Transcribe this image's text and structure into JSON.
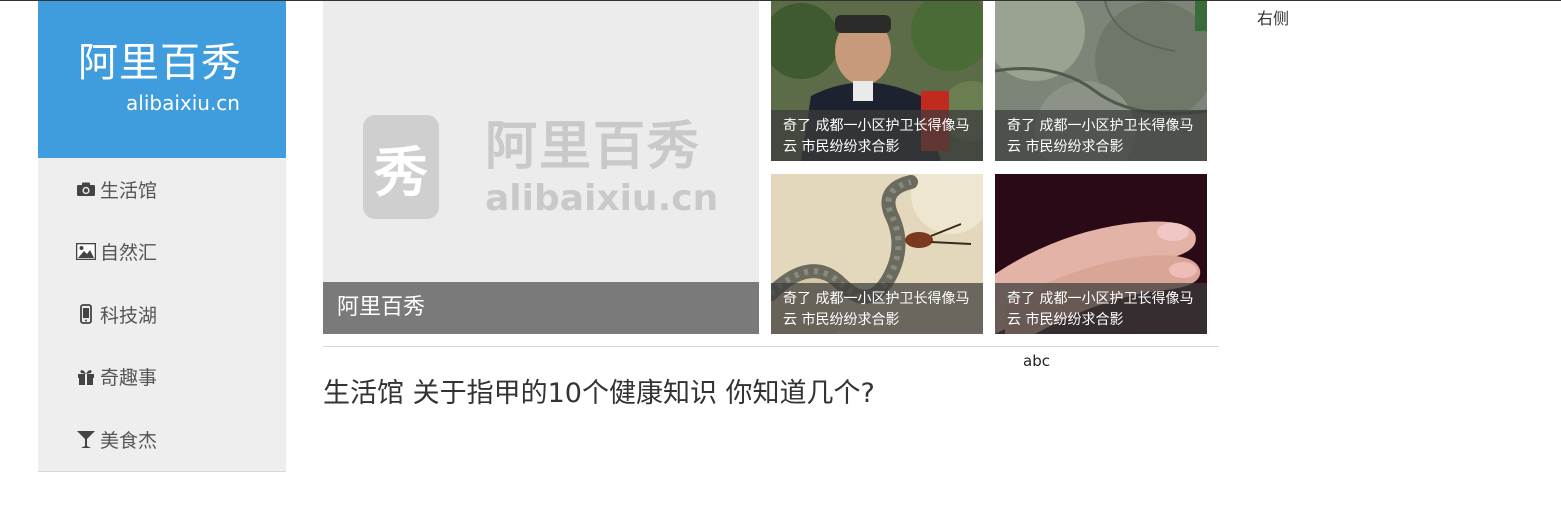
{
  "logo": {
    "cn": "阿里百秀",
    "en": "alibaixiu.cn"
  },
  "sidebar": {
    "items": [
      {
        "label": "生活馆",
        "icon": "camera-icon"
      },
      {
        "label": "自然汇",
        "icon": "picture-icon"
      },
      {
        "label": "科技湖",
        "icon": "phone-icon"
      },
      {
        "label": "奇趣事",
        "icon": "gift-icon"
      },
      {
        "label": "美食杰",
        "icon": "cocktail-glass-icon"
      }
    ]
  },
  "hero": {
    "watermark_badge": "秀",
    "watermark_cn": "阿里百秀",
    "watermark_en": "alibaixiu.cn",
    "caption": "阿里百秀"
  },
  "thumbs": [
    {
      "caption": "奇了 成都一小区护卫长得像马云 市民纷纷求合影"
    },
    {
      "caption": "奇了 成都一小区护卫长得像马云 市民纷纷求合影"
    },
    {
      "caption": "奇了 成都一小区护卫长得像马云 市民纷纷求合影"
    },
    {
      "caption": "奇了 成都一小区护卫长得像马云 市民纷纷求合影"
    }
  ],
  "abc_label": "abc",
  "article": {
    "title": "生活馆 关于指甲的10个健康知识 你知道几个?"
  },
  "right_column": {
    "label": "右侧"
  },
  "colors": {
    "brand_blue": "#3f9cdd",
    "sidebar_bg": "#eeeeee",
    "caption_bg": "#7a7a7a"
  }
}
